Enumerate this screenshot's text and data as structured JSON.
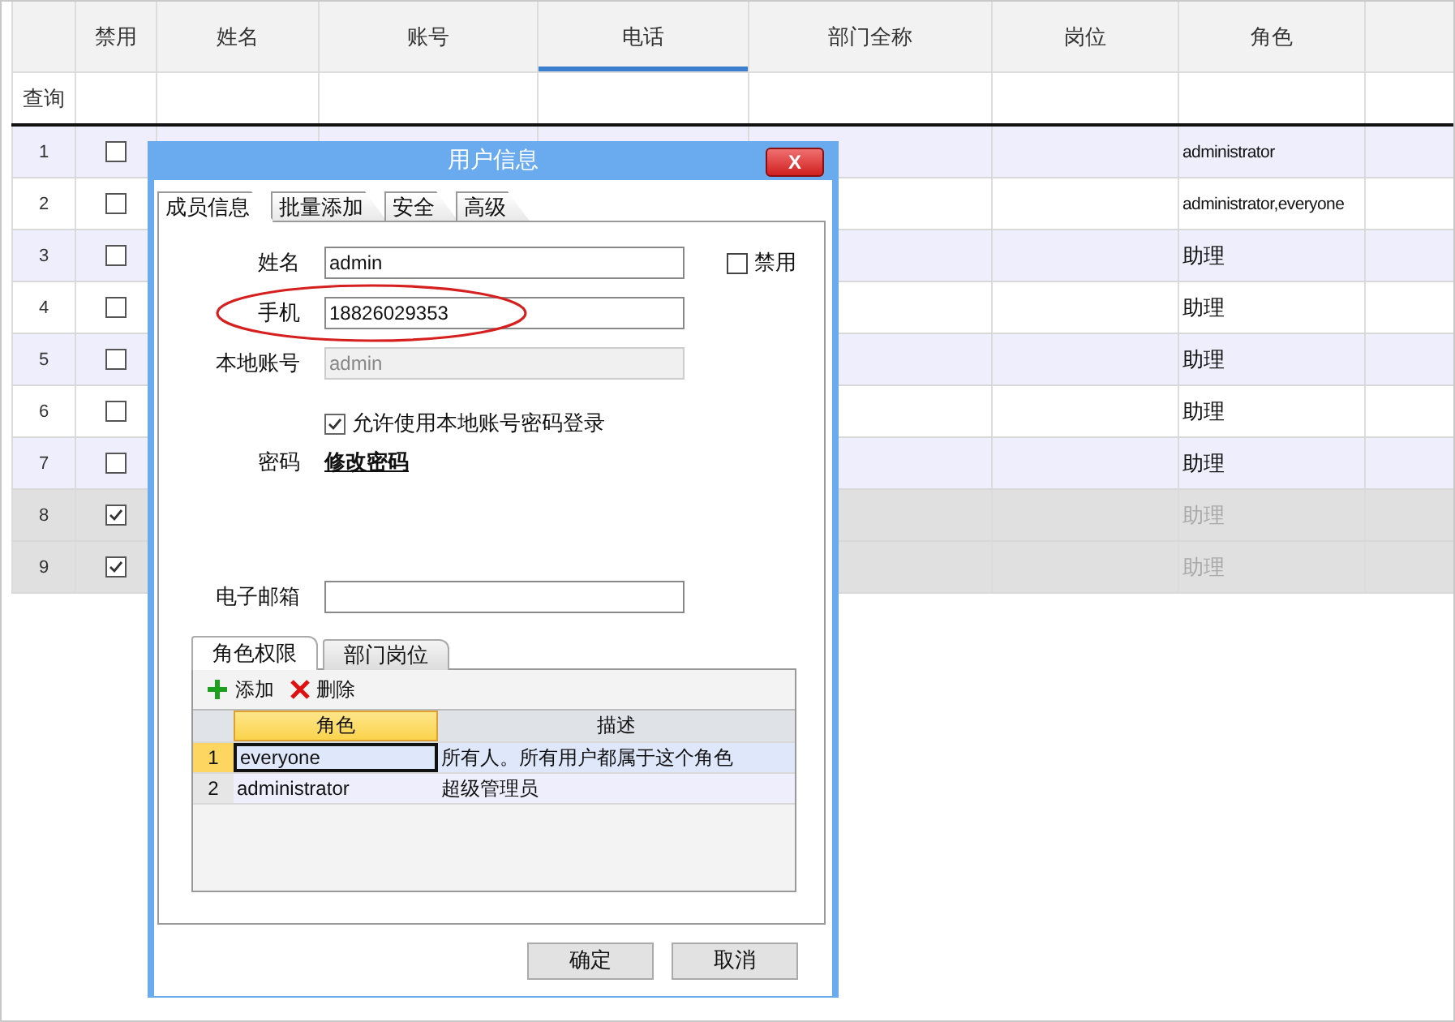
{
  "table": {
    "columns": [
      {
        "label": "禁用",
        "selected": false
      },
      {
        "label": "姓名",
        "selected": false
      },
      {
        "label": "账号",
        "selected": false
      },
      {
        "label": "电话",
        "selected": true
      },
      {
        "label": "部门全称",
        "selected": false
      },
      {
        "label": "岗位",
        "selected": false
      },
      {
        "label": "角色",
        "selected": false
      }
    ],
    "query_label": "查询",
    "rows": [
      {
        "number": "1",
        "disabled": false,
        "role": "administrator"
      },
      {
        "number": "2",
        "disabled": false,
        "role": "administrator,everyone"
      },
      {
        "number": "3",
        "disabled": false,
        "role": "助理"
      },
      {
        "number": "4",
        "disabled": false,
        "role": "助理"
      },
      {
        "number": "5",
        "disabled": false,
        "role": "助理"
      },
      {
        "number": "6",
        "disabled": false,
        "role": "助理"
      },
      {
        "number": "7",
        "disabled": false,
        "role": "助理"
      },
      {
        "number": "8",
        "disabled": true,
        "role": "助理"
      },
      {
        "number": "9",
        "disabled": true,
        "role": "助理"
      }
    ]
  },
  "dialog": {
    "title": "用户信息",
    "close": "X",
    "tabs": [
      {
        "label": "成员信息",
        "selected": true
      },
      {
        "label": "批量添加",
        "selected": false
      },
      {
        "label": "安全",
        "selected": false
      },
      {
        "label": "高级",
        "selected": false
      }
    ],
    "fields": [
      {
        "kind": "input",
        "label": "姓名",
        "value": "admin"
      },
      {
        "kind": "input",
        "label": "手机",
        "value": "18826029353",
        "circled": true
      },
      {
        "kind": "readonly",
        "label": "本地账号",
        "value": "admin"
      },
      {
        "kind": "checkbox",
        "label": "允许使用本地账号密码登录",
        "checked": true
      },
      {
        "kind": "link",
        "label": "密码",
        "value": "修改密码"
      }
    ],
    "disable_checkbox": {
      "label": "禁用",
      "checked": false
    },
    "email_field": {
      "label": "电子邮箱"
    },
    "subtabs": [
      {
        "label": "角色权限",
        "selected": true
      },
      {
        "label": "部门岗位",
        "selected": false
      }
    ],
    "toolbar": [
      {
        "kind": "add",
        "label": "添加"
      },
      {
        "kind": "delete",
        "label": "删除"
      }
    ],
    "grid": {
      "columns": [
        {
          "label": "角色",
          "selected": true
        },
        {
          "label": "描述",
          "selected": false
        }
      ],
      "rows": [
        {
          "number": "1",
          "role": "everyone",
          "description": "所有人。所有用户都属于这个角色",
          "selected": true
        },
        {
          "number": "2",
          "role": "administrator",
          "description": "超级管理员",
          "selected": false
        }
      ]
    },
    "buttons": [
      "确定",
      "取消"
    ]
  }
}
